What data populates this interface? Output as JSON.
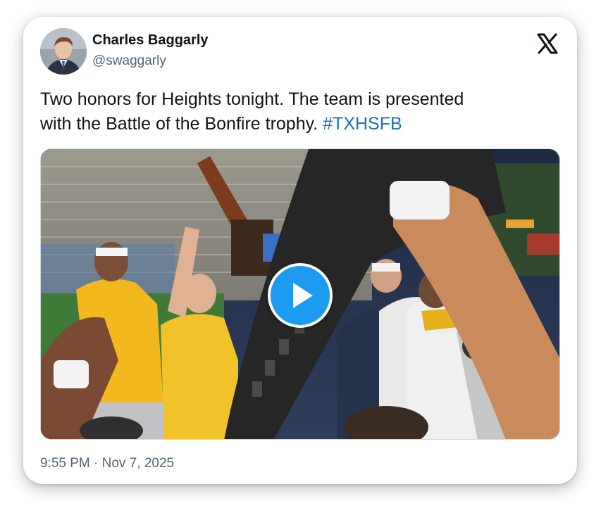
{
  "author": {
    "display_name": "Charles Baggarly",
    "handle": "@swaggarly"
  },
  "platform_icon": "x-logo-icon",
  "tweet": {
    "text_before_line1": "Two honors for Heights tonight. The team is presented",
    "text_before_line2": "with the Battle of the Bonfire trophy. ",
    "hashtag": "#TXHSFB"
  },
  "media": {
    "type": "video",
    "play_icon": "play-icon"
  },
  "footer": {
    "timestamp": "9:55 PM · Nov 7, 2025"
  },
  "colors": {
    "link": "#1d6fb8",
    "play_button": "#1d9bf0",
    "secondary_text": "#536471"
  }
}
